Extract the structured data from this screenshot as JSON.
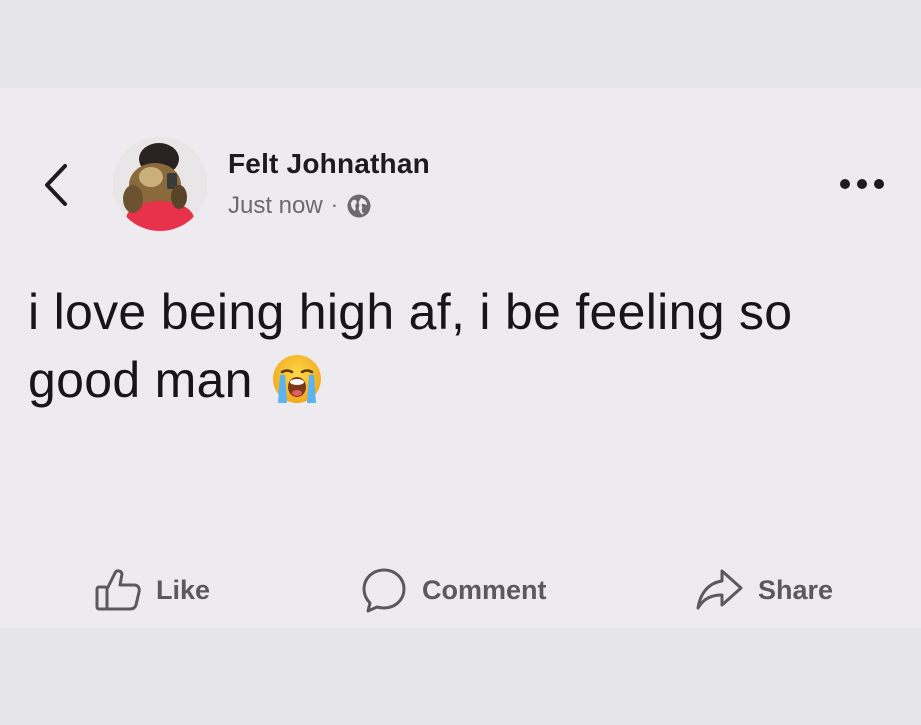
{
  "post": {
    "author": "Felt Johnathan",
    "timestamp": "Just now",
    "separator": "·",
    "visibility_icon": "globe-icon",
    "text": "i love being high af, i be feeling so good man",
    "emoji": "loudly-crying-face"
  },
  "header": {
    "back_icon": "chevron-left-icon",
    "more_icon": "more-horizontal-icon"
  },
  "actions": {
    "like": {
      "label": "Like",
      "icon": "thumbs-up-icon"
    },
    "comment": {
      "label": "Comment",
      "icon": "comment-bubble-icon"
    },
    "share": {
      "label": "Share",
      "icon": "share-arrow-icon"
    }
  },
  "colors": {
    "background": "#e6e5e9",
    "card": "#edebef",
    "text_primary": "#161618",
    "text_secondary": "#6b6a70",
    "action_text": "#5a595f"
  }
}
